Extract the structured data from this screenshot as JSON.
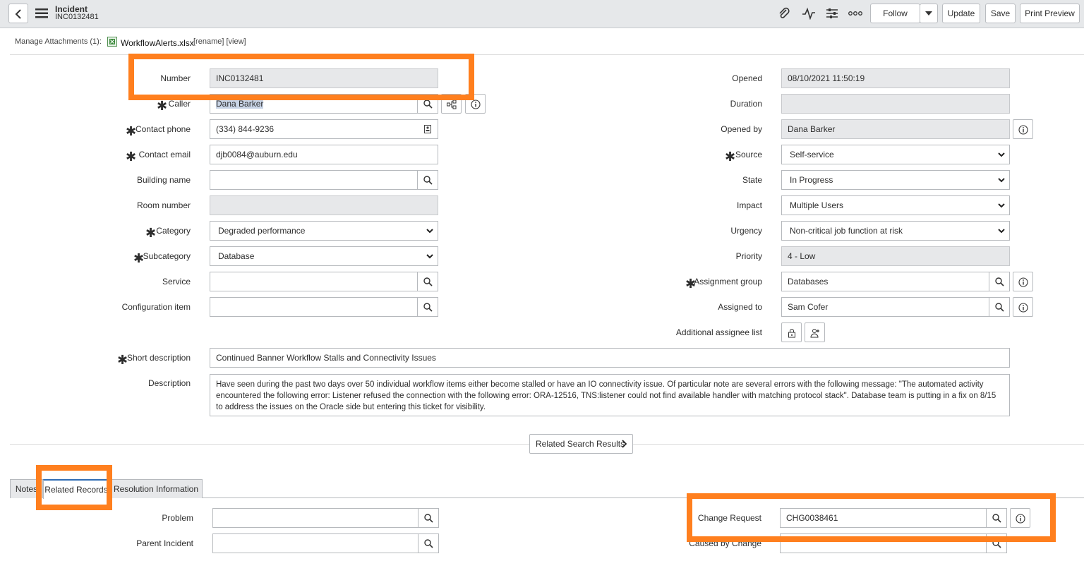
{
  "header": {
    "title": "Incident",
    "number": "INC0132481",
    "follow_label": "Follow",
    "update_label": "Update",
    "save_label": "Save",
    "print_preview_label": "Print Preview"
  },
  "attachments": {
    "label": "Manage Attachments (1):",
    "file_name": "WorkflowAlerts.xlsx",
    "actions": "[rename] [view]"
  },
  "form": {
    "number": {
      "label": "Number",
      "value": "INC0132481"
    },
    "caller": {
      "label": "Caller",
      "value": "Dana Barker"
    },
    "contact_phone": {
      "label": "Contact phone",
      "value": "(334) 844-9236"
    },
    "contact_email": {
      "label": "Contact email",
      "value": "djb0084@auburn.edu"
    },
    "building_name": {
      "label": "Building name",
      "value": ""
    },
    "room_number": {
      "label": "Room number",
      "value": ""
    },
    "category": {
      "label": "Category",
      "value": "Degraded performance"
    },
    "subcategory": {
      "label": "Subcategory",
      "value": "Database"
    },
    "service": {
      "label": "Service",
      "value": ""
    },
    "configuration_item": {
      "label": "Configuration item",
      "value": ""
    },
    "opened": {
      "label": "Opened",
      "value": "08/10/2021 11:50:19"
    },
    "duration": {
      "label": "Duration",
      "value": ""
    },
    "opened_by": {
      "label": "Opened by",
      "value": "Dana Barker"
    },
    "source": {
      "label": "Source",
      "value": "Self-service"
    },
    "state": {
      "label": "State",
      "value": "In Progress"
    },
    "impact": {
      "label": "Impact",
      "value": "Multiple Users"
    },
    "urgency": {
      "label": "Urgency",
      "value": "Non-critical job function at risk"
    },
    "priority": {
      "label": "Priority",
      "value": "4 - Low"
    },
    "assignment_group": {
      "label": "Assignment group",
      "value": "Databases"
    },
    "assigned_to": {
      "label": "Assigned to",
      "value": "Sam Cofer"
    },
    "additional_assignee": {
      "label": "Additional assignee list"
    },
    "short_description": {
      "label": "Short description",
      "value": "Continued Banner Workflow Stalls and Connectivity Issues"
    },
    "description": {
      "label": "Description",
      "value": "Have seen during the past two days over 50 individual workflow items either become stalled or have an IO connectivity issue. Of particular note are several errors with the following message: \"The automated activity encountered the following error: Listener refused the connection with the following error: ORA-12516, TNS:listener could not find available handler with matching protocol stack\". Database team is putting in a fix on 8/15 to address the issues on the Oracle side but entering this ticket for visibility."
    }
  },
  "related_search_label": "Related Search Results",
  "tabs": [
    {
      "label": "Notes"
    },
    {
      "label": "Related Records"
    },
    {
      "label": "Resolution Information"
    }
  ],
  "related": {
    "problem": {
      "label": "Problem",
      "value": ""
    },
    "parent_incident": {
      "label": "Parent Incident",
      "value": ""
    },
    "change_request": {
      "label": "Change Request",
      "value": "CHG0038461"
    },
    "caused_by_change": {
      "label": "Caused by Change",
      "value": ""
    }
  },
  "colors": {
    "highlight": "#ff7f1e",
    "active_tab": "#2f6db5"
  }
}
